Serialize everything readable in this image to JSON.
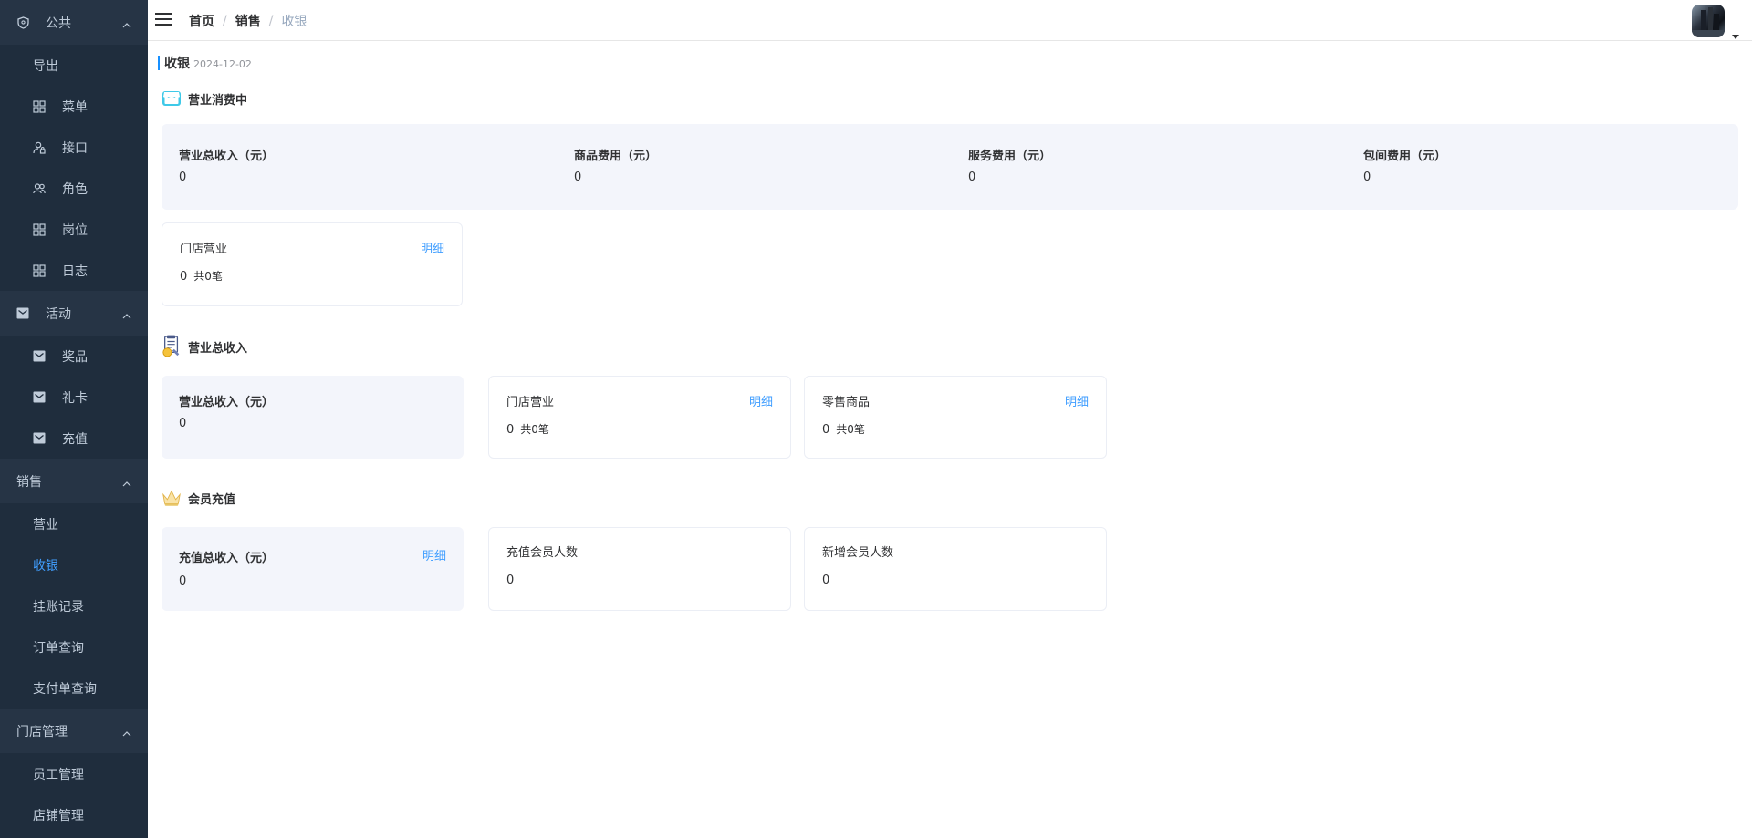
{
  "sidebar": {
    "groups": [
      {
        "label": "公共",
        "items": [
          "导出",
          "菜单",
          "接口",
          "角色",
          "岗位",
          "日志"
        ]
      },
      {
        "label": "活动",
        "items": [
          "奖品",
          "礼卡",
          "充值"
        ]
      },
      {
        "label": "销售",
        "items": [
          "营业",
          "收银",
          "挂账记录",
          "订单查询",
          "支付单查询"
        ]
      },
      {
        "label": "门店管理",
        "items": [
          "员工管理",
          "店铺管理"
        ]
      }
    ],
    "active_item": "收银",
    "colors": {
      "bg": "#1f2d3d",
      "group_bg": "#263445",
      "text": "#bfcbd9",
      "active": "#409eff"
    }
  },
  "header": {
    "breadcrumb": [
      "首页",
      "销售",
      "收银"
    ]
  },
  "page": {
    "title": "收银",
    "date": "2024-12-02"
  },
  "sections": {
    "consumption": {
      "title": "营业消费中",
      "stats": [
        {
          "label": "营业总收入（元）",
          "value": "0"
        },
        {
          "label": "商品费用（元）",
          "value": "0"
        },
        {
          "label": "服务费用（元）",
          "value": "0"
        },
        {
          "label": "包间费用（元）",
          "value": "0"
        }
      ],
      "store_card": {
        "label": "门店营业",
        "link": "明细",
        "value": "0",
        "count": "共0笔"
      }
    },
    "income": {
      "title": "营业总收入",
      "total": {
        "label": "营业总收入（元）",
        "value": "0"
      },
      "store_card": {
        "label": "门店营业",
        "link": "明细",
        "value": "0",
        "count": "共0笔"
      },
      "retail_card": {
        "label": "零售商品",
        "link": "明细",
        "value": "0",
        "count": "共0笔"
      }
    },
    "member": {
      "title": "会员充值",
      "total": {
        "label": "充值总收入（元）",
        "link": "明细",
        "value": "0"
      },
      "recharge_count": {
        "label": "充值会员人数",
        "value": "0"
      },
      "new_count": {
        "label": "新增会员人数",
        "value": "0"
      }
    }
  },
  "icons": {
    "group_public": "shield-icon",
    "group_activity": "envelope-icon",
    "menu": "grid-icon",
    "api": "user-lock-icon",
    "role": "people-icon",
    "consumption": "store-icon",
    "income": "receipt-icon",
    "member": "crown-icon"
  }
}
